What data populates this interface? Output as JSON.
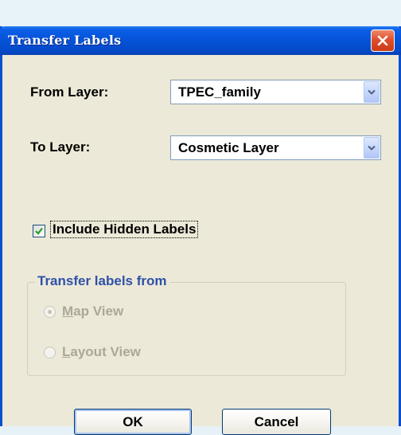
{
  "dialog": {
    "title": "Transfer Labels"
  },
  "form": {
    "from_layer_label": "From Layer:",
    "from_layer_value": "TPEC_family",
    "to_layer_label": "To Layer:",
    "to_layer_value": "Cosmetic Layer",
    "include_hidden_label": "Include Hidden Labels",
    "include_hidden_checked": true
  },
  "transfer_group": {
    "title": "Transfer labels from",
    "options": [
      {
        "mnemonic": "M",
        "rest": "ap View",
        "selected": true,
        "enabled": false
      },
      {
        "mnemonic": "L",
        "rest": "ayout View",
        "selected": false,
        "enabled": false
      }
    ]
  },
  "buttons": {
    "ok_label": "OK",
    "cancel_label": "Cancel"
  },
  "colors": {
    "titlebar": "#0553d8",
    "close_button": "#e0502e",
    "dialog_face": "#ece9d8",
    "group_title": "#2f52a8",
    "disabled_text": "#aca899"
  },
  "icons": {
    "close": "close-icon",
    "dropdown": "chevron-down-icon",
    "check": "checkmark-icon"
  }
}
